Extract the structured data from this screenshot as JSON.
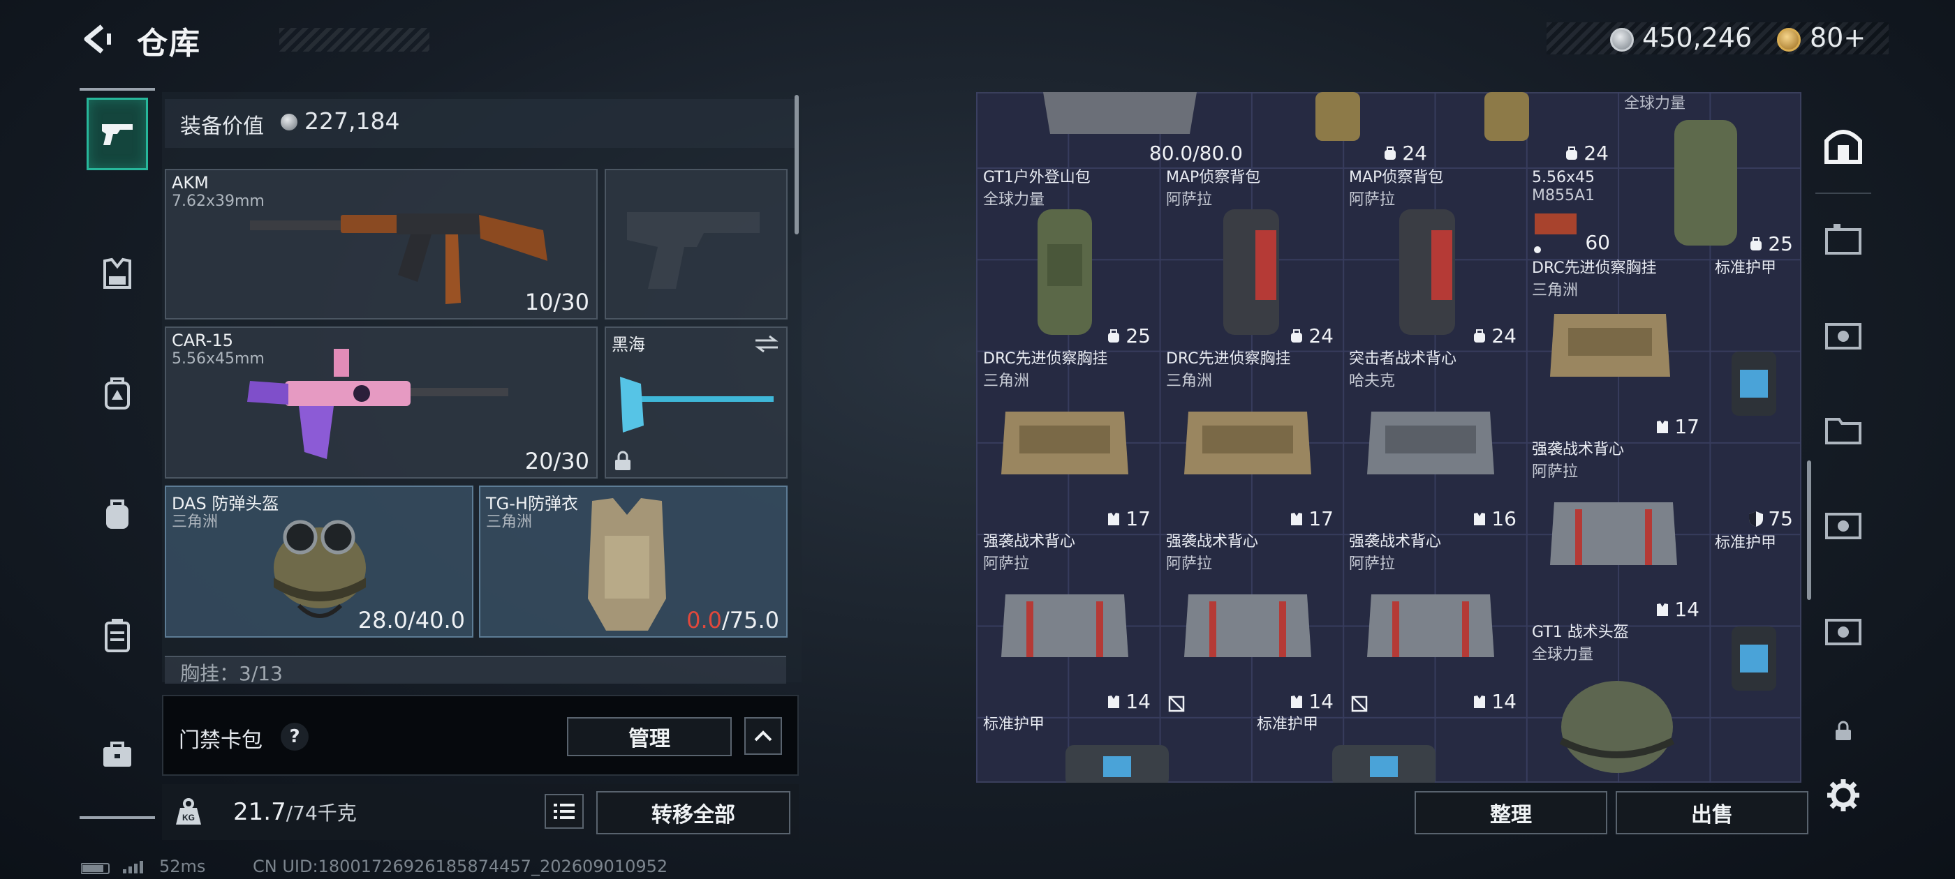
{
  "header": {
    "title": "仓库",
    "coin_amount": "450,246",
    "token_amount": "80+"
  },
  "equipment": {
    "value_label": "装备价值",
    "value": "227,184",
    "slots": [
      {
        "name": "AKM",
        "sub": "7.62x39mm",
        "count": "10/30"
      },
      {
        "name": "",
        "sub": "",
        "count": ""
      },
      {
        "name": "CAR-15",
        "sub": "5.56x45mm",
        "count": "20/30"
      },
      {
        "name": "黑海",
        "sub": "",
        "count": ""
      },
      {
        "name": "DAS 防弹头盔",
        "sub": "三角洲",
        "count": "28.0/40.0"
      },
      {
        "name": "TG-H防弹衣",
        "sub": "三角洲",
        "count_current": "0.0",
        "count_max": "/75.0"
      }
    ],
    "chest_rig_partial": "胸挂：3/13",
    "keycard_label": "门禁卡包",
    "manage_button": "管理",
    "weight_current": "21.7",
    "weight_max": "/74千克",
    "transfer_all_button": "转移全部"
  },
  "stash": {
    "top_row": [
      {
        "count": "80.0/80.0"
      },
      {
        "count": "24"
      },
      {
        "count": "24"
      },
      {
        "name": "全球力量"
      },
      {
        "count": "25"
      }
    ],
    "items": [
      {
        "name": "GT1户外登山包",
        "sub": "全球力量",
        "count": "25"
      },
      {
        "name": "MAP侦察背包",
        "sub": "阿萨拉",
        "count": "24"
      },
      {
        "name": "MAP侦察背包",
        "sub": "阿萨拉",
        "count": "24"
      },
      {
        "name": "5.56x45",
        "sub": "M855A1",
        "count": "60"
      },
      {
        "name": "DRC先进侦察胸挂",
        "sub": "三角洲",
        "count": "17"
      },
      {
        "name": "标准护甲",
        "sub": "",
        "count": ""
      },
      {
        "name": "DRC先进侦察胸挂",
        "sub": "三角洲",
        "count": "17"
      },
      {
        "name": "DRC先进侦察胸挂",
        "sub": "三角洲",
        "count": "17"
      },
      {
        "name": "突击者战术背心",
        "sub": "哈夫克",
        "count": "16"
      },
      {
        "name": "强袭战术背心",
        "sub": "阿萨拉",
        "count": "14"
      },
      {
        "name": "",
        "sub": "",
        "count": "75"
      },
      {
        "name": "标准护甲",
        "sub": "",
        "count": ""
      },
      {
        "name": "强袭战术背心",
        "sub": "阿萨拉",
        "count": "14"
      },
      {
        "name": "强袭战术背心",
        "sub": "阿萨拉",
        "count": "14"
      },
      {
        "name": "强袭战术背心",
        "sub": "阿萨拉",
        "count": "14"
      },
      {
        "name": "GT1 战术头盔",
        "sub": "全球力量",
        "count": ""
      },
      {
        "name": "标准护甲",
        "sub": "",
        "count": ""
      },
      {
        "name": "标准护甲",
        "sub": "",
        "count": ""
      }
    ],
    "sort_button": "整理",
    "sell_button": "出售"
  },
  "status": {
    "ping": "52ms",
    "uid": "CN UID:18001726926185874457_202609010952"
  },
  "colors": {
    "accent": "#27b79b",
    "stash_bg": "#262a42",
    "armor_red": "#e0483c"
  }
}
